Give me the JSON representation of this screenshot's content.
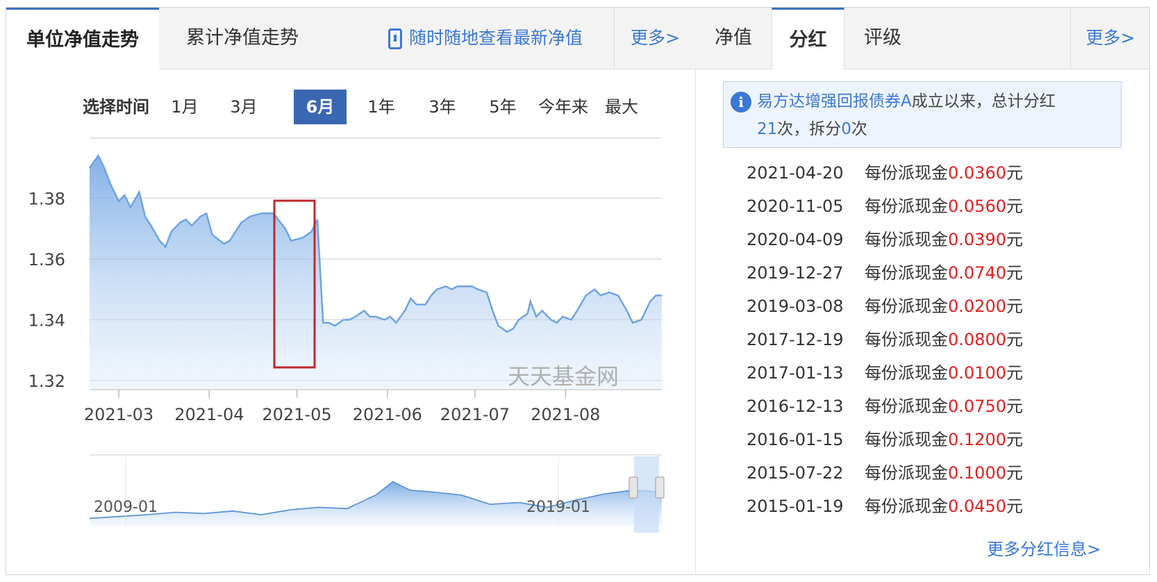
{
  "left_panel": {
    "tabs": [
      {
        "label": "单位净值走势",
        "active": true
      },
      {
        "label": "累计净值走势",
        "active": false
      }
    ],
    "app_link": "随时随地查看最新净值",
    "more": "更多>",
    "time_selector": {
      "label": "选择时间",
      "options": [
        "1月",
        "3月",
        "6月",
        "1年",
        "3年",
        "5年",
        "今年来",
        "最大"
      ],
      "selected": "6月"
    },
    "watermark": "天天基金网",
    "accent_color": "#3a67b2",
    "highlight_box_color": "#c0282c"
  },
  "chart_data": {
    "type": "area",
    "x_tick_labels": [
      "2021-03",
      "2021-04",
      "2021-05",
      "2021-06",
      "2021-07",
      "2021-08"
    ],
    "y_tick_labels": [
      "1.38",
      "1.36",
      "1.34",
      "1.32"
    ],
    "ylim": [
      1.317,
      1.397
    ],
    "xlim": [
      "2021-02-19",
      "2021-08-12"
    ],
    "grid": true,
    "color": "#6fa3e3",
    "series": [
      {
        "points": [
          [
            "2021-02-19",
            1.39
          ],
          [
            "2021-02-22",
            1.394
          ],
          [
            "2021-02-24",
            1.39
          ],
          [
            "2021-02-26",
            1.385
          ],
          [
            "2021-03-01",
            1.379
          ],
          [
            "2021-03-03",
            1.381
          ],
          [
            "2021-03-05",
            1.377
          ],
          [
            "2021-03-08",
            1.382
          ],
          [
            "2021-03-10",
            1.374
          ],
          [
            "2021-03-12",
            1.371
          ],
          [
            "2021-03-15",
            1.366
          ],
          [
            "2021-03-17",
            1.364
          ],
          [
            "2021-03-19",
            1.369
          ],
          [
            "2021-03-22",
            1.372
          ],
          [
            "2021-03-24",
            1.373
          ],
          [
            "2021-03-26",
            1.371
          ],
          [
            "2021-03-29",
            1.374
          ],
          [
            "2021-03-31",
            1.375
          ],
          [
            "2021-04-02",
            1.368
          ],
          [
            "2021-04-06",
            1.365
          ],
          [
            "2021-04-08",
            1.366
          ],
          [
            "2021-04-12",
            1.372
          ],
          [
            "2021-04-15",
            1.374
          ],
          [
            "2021-04-19",
            1.375
          ],
          [
            "2021-04-23",
            1.375
          ],
          [
            "2021-04-27",
            1.37
          ],
          [
            "2021-04-29",
            1.366
          ],
          [
            "2021-05-03",
            1.367
          ],
          [
            "2021-05-06",
            1.369
          ],
          [
            "2021-05-08",
            1.373
          ],
          [
            "2021-05-10",
            1.339
          ],
          [
            "2021-05-12",
            1.339
          ],
          [
            "2021-05-14",
            1.338
          ],
          [
            "2021-05-17",
            1.34
          ],
          [
            "2021-05-19",
            1.34
          ],
          [
            "2021-05-21",
            1.341
          ],
          [
            "2021-05-24",
            1.343
          ],
          [
            "2021-05-26",
            1.341
          ],
          [
            "2021-05-28",
            1.341
          ],
          [
            "2021-05-31",
            1.34
          ],
          [
            "2021-06-02",
            1.341
          ],
          [
            "2021-06-04",
            1.339
          ],
          [
            "2021-06-07",
            1.343
          ],
          [
            "2021-06-09",
            1.347
          ],
          [
            "2021-06-11",
            1.345
          ],
          [
            "2021-06-14",
            1.345
          ],
          [
            "2021-06-16",
            1.348
          ],
          [
            "2021-06-18",
            1.35
          ],
          [
            "2021-06-21",
            1.351
          ],
          [
            "2021-06-23",
            1.35
          ],
          [
            "2021-06-25",
            1.351
          ],
          [
            "2021-06-28",
            1.351
          ],
          [
            "2021-06-30",
            1.351
          ],
          [
            "2021-07-02",
            1.35
          ],
          [
            "2021-07-05",
            1.349
          ],
          [
            "2021-07-07",
            1.343
          ],
          [
            "2021-07-09",
            1.338
          ],
          [
            "2021-07-12",
            1.336
          ],
          [
            "2021-07-14",
            1.337
          ],
          [
            "2021-07-16",
            1.34
          ],
          [
            "2021-07-19",
            1.342
          ],
          [
            "2021-07-20",
            1.346
          ],
          [
            "2021-07-22",
            1.341
          ],
          [
            "2021-07-24",
            1.343
          ],
          [
            "2021-07-27",
            1.34
          ],
          [
            "2021-07-29",
            1.339
          ],
          [
            "2021-07-31",
            1.341
          ],
          [
            "2021-08-03",
            1.34
          ],
          [
            "2021-08-05",
            1.343
          ],
          [
            "2021-08-08",
            1.348
          ],
          [
            "2021-08-11",
            1.35
          ],
          [
            "2021-08-13",
            1.348
          ],
          [
            "2021-08-16",
            1.349
          ],
          [
            "2021-08-19",
            1.348
          ],
          [
            "2021-08-22",
            1.343
          ],
          [
            "2021-08-24",
            1.339
          ],
          [
            "2021-08-27",
            1.34
          ],
          [
            "2021-08-30",
            1.346
          ],
          [
            "2021-09-01",
            1.348
          ],
          [
            "2021-09-03",
            1.348
          ]
        ]
      }
    ]
  },
  "overview_chart": {
    "x_tick_labels": [
      "2009-01",
      "2019-01"
    ],
    "description_points": [
      [
        0,
        0.12
      ],
      [
        0.05,
        0.15
      ],
      [
        0.1,
        0.18
      ],
      [
        0.15,
        0.22
      ],
      [
        0.2,
        0.2
      ],
      [
        0.25,
        0.24
      ],
      [
        0.3,
        0.18
      ],
      [
        0.35,
        0.26
      ],
      [
        0.4,
        0.3
      ],
      [
        0.45,
        0.28
      ],
      [
        0.5,
        0.5
      ],
      [
        0.53,
        0.72
      ],
      [
        0.56,
        0.58
      ],
      [
        0.6,
        0.55
      ],
      [
        0.65,
        0.5
      ],
      [
        0.7,
        0.35
      ],
      [
        0.75,
        0.38
      ],
      [
        0.8,
        0.3
      ],
      [
        0.85,
        0.42
      ],
      [
        0.9,
        0.52
      ],
      [
        0.95,
        0.58
      ],
      [
        1.0,
        0.55
      ]
    ]
  },
  "right_panel": {
    "tabs": [
      {
        "label": "净值",
        "active": false
      },
      {
        "label": "分红",
        "active": true
      },
      {
        "label": "评级",
        "active": false
      }
    ],
    "more": "更多>",
    "notice": {
      "fund_name": "易方达增强回报债券A",
      "text1": "成立以来，总计分红",
      "count": "21",
      "text2": "次，拆分",
      "splits": "0",
      "text3": "次"
    },
    "dividend_prefix": "每份派现金",
    "dividend_suffix": "元",
    "dividends": [
      {
        "date": "2021-04-20",
        "amount": "0.0360"
      },
      {
        "date": "2020-11-05",
        "amount": "0.0560"
      },
      {
        "date": "2020-04-09",
        "amount": "0.0390"
      },
      {
        "date": "2019-12-27",
        "amount": "0.0740"
      },
      {
        "date": "2019-03-08",
        "amount": "0.0200"
      },
      {
        "date": "2017-12-19",
        "amount": "0.0800"
      },
      {
        "date": "2017-01-13",
        "amount": "0.0100"
      },
      {
        "date": "2016-12-13",
        "amount": "0.0750"
      },
      {
        "date": "2016-01-15",
        "amount": "0.1200"
      },
      {
        "date": "2015-07-22",
        "amount": "0.1000"
      },
      {
        "date": "2015-01-19",
        "amount": "0.0450"
      }
    ],
    "more_dividends": "更多分红信息>"
  }
}
